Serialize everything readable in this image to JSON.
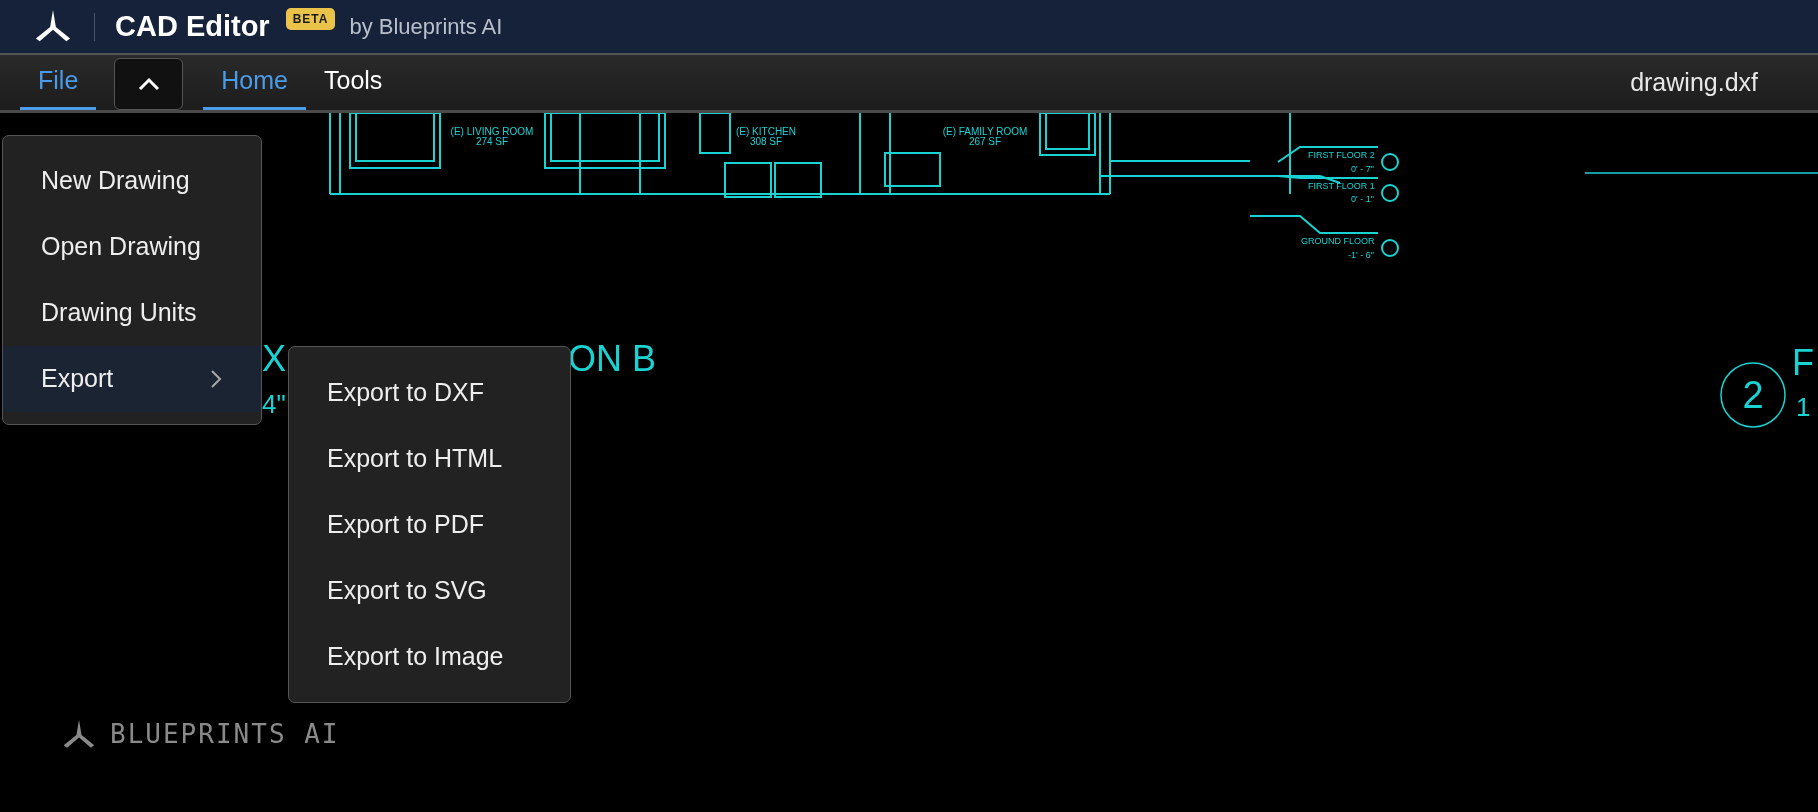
{
  "app": {
    "title": "CAD Editor",
    "badge": "BETA",
    "byline": "by Blueprints AI"
  },
  "toolbar": {
    "menus": [
      {
        "label": "File",
        "selected": true
      }
    ],
    "tabs": [
      {
        "label": "Home",
        "selected": true
      },
      {
        "label": "Tools",
        "selected": false
      }
    ],
    "filename": "drawing.dxf"
  },
  "file_menu": {
    "items": [
      {
        "label": "New Drawing",
        "selected": false,
        "submenu": false
      },
      {
        "label": "Open Drawing",
        "selected": false,
        "submenu": false
      },
      {
        "label": "Drawing Units",
        "selected": false,
        "submenu": false
      },
      {
        "label": "Export",
        "selected": true,
        "submenu": true
      }
    ]
  },
  "export_menu": {
    "items": [
      "Export to DXF",
      "Export to HTML",
      "Export to PDF",
      "Export to SVG",
      "Export to Image"
    ]
  },
  "drawing": {
    "labels": [
      {
        "text": "(E) LIVING ROOM",
        "kind": "room"
      },
      {
        "text": "274 SF",
        "kind": "room"
      },
      {
        "text": "(E) KITCHEN",
        "kind": "room"
      },
      {
        "text": "308 SF",
        "kind": "room"
      },
      {
        "text": "(E) FAMILY ROOM",
        "kind": "room"
      },
      {
        "text": "267 SF",
        "kind": "room"
      },
      {
        "text": "FIRST FLOOR 2",
        "kind": "level"
      },
      {
        "text": "0' - 7\"",
        "kind": "level"
      },
      {
        "text": "FIRST FLOOR 1",
        "kind": "level"
      },
      {
        "text": "0' - 1\"",
        "kind": "level"
      },
      {
        "text": "GROUND FLOOR",
        "kind": "level"
      },
      {
        "text": "-1' - 6\"",
        "kind": "level"
      },
      {
        "text": "X",
        "kind": "title"
      },
      {
        "text": "ON B",
        "kind": "title"
      },
      {
        "text": "4\"",
        "kind": "scale"
      },
      {
        "text": "2",
        "kind": "number"
      },
      {
        "text": "F",
        "kind": "title"
      },
      {
        "text": "1",
        "kind": "scale"
      }
    ]
  },
  "brand": {
    "text": "BLUEPRINTS AI"
  }
}
